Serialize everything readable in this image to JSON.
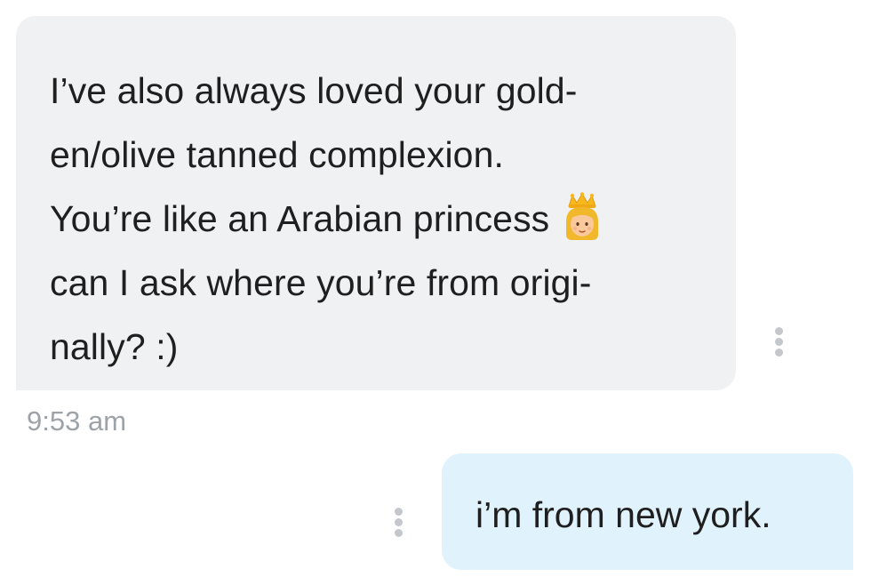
{
  "incoming_message": {
    "lines": [
      "I’ve also always loved your gold-",
      "en/olive tanned complexion.",
      "You’re like an Arabian princess",
      "can I ask where you’re from origi-",
      "nally? :)"
    ],
    "emoji": "princess-icon",
    "timestamp": "9:53 am"
  },
  "outgoing_message": {
    "text": "i’m from new york."
  },
  "icons": {
    "more": "more-vertical-icon"
  },
  "colors": {
    "incoming_bubble": "#f0f1f3",
    "outgoing_bubble": "#e0f2fb",
    "text": "#1f1f1f",
    "timestamp": "#9ea3a9",
    "dots": "#c4c7cc"
  }
}
